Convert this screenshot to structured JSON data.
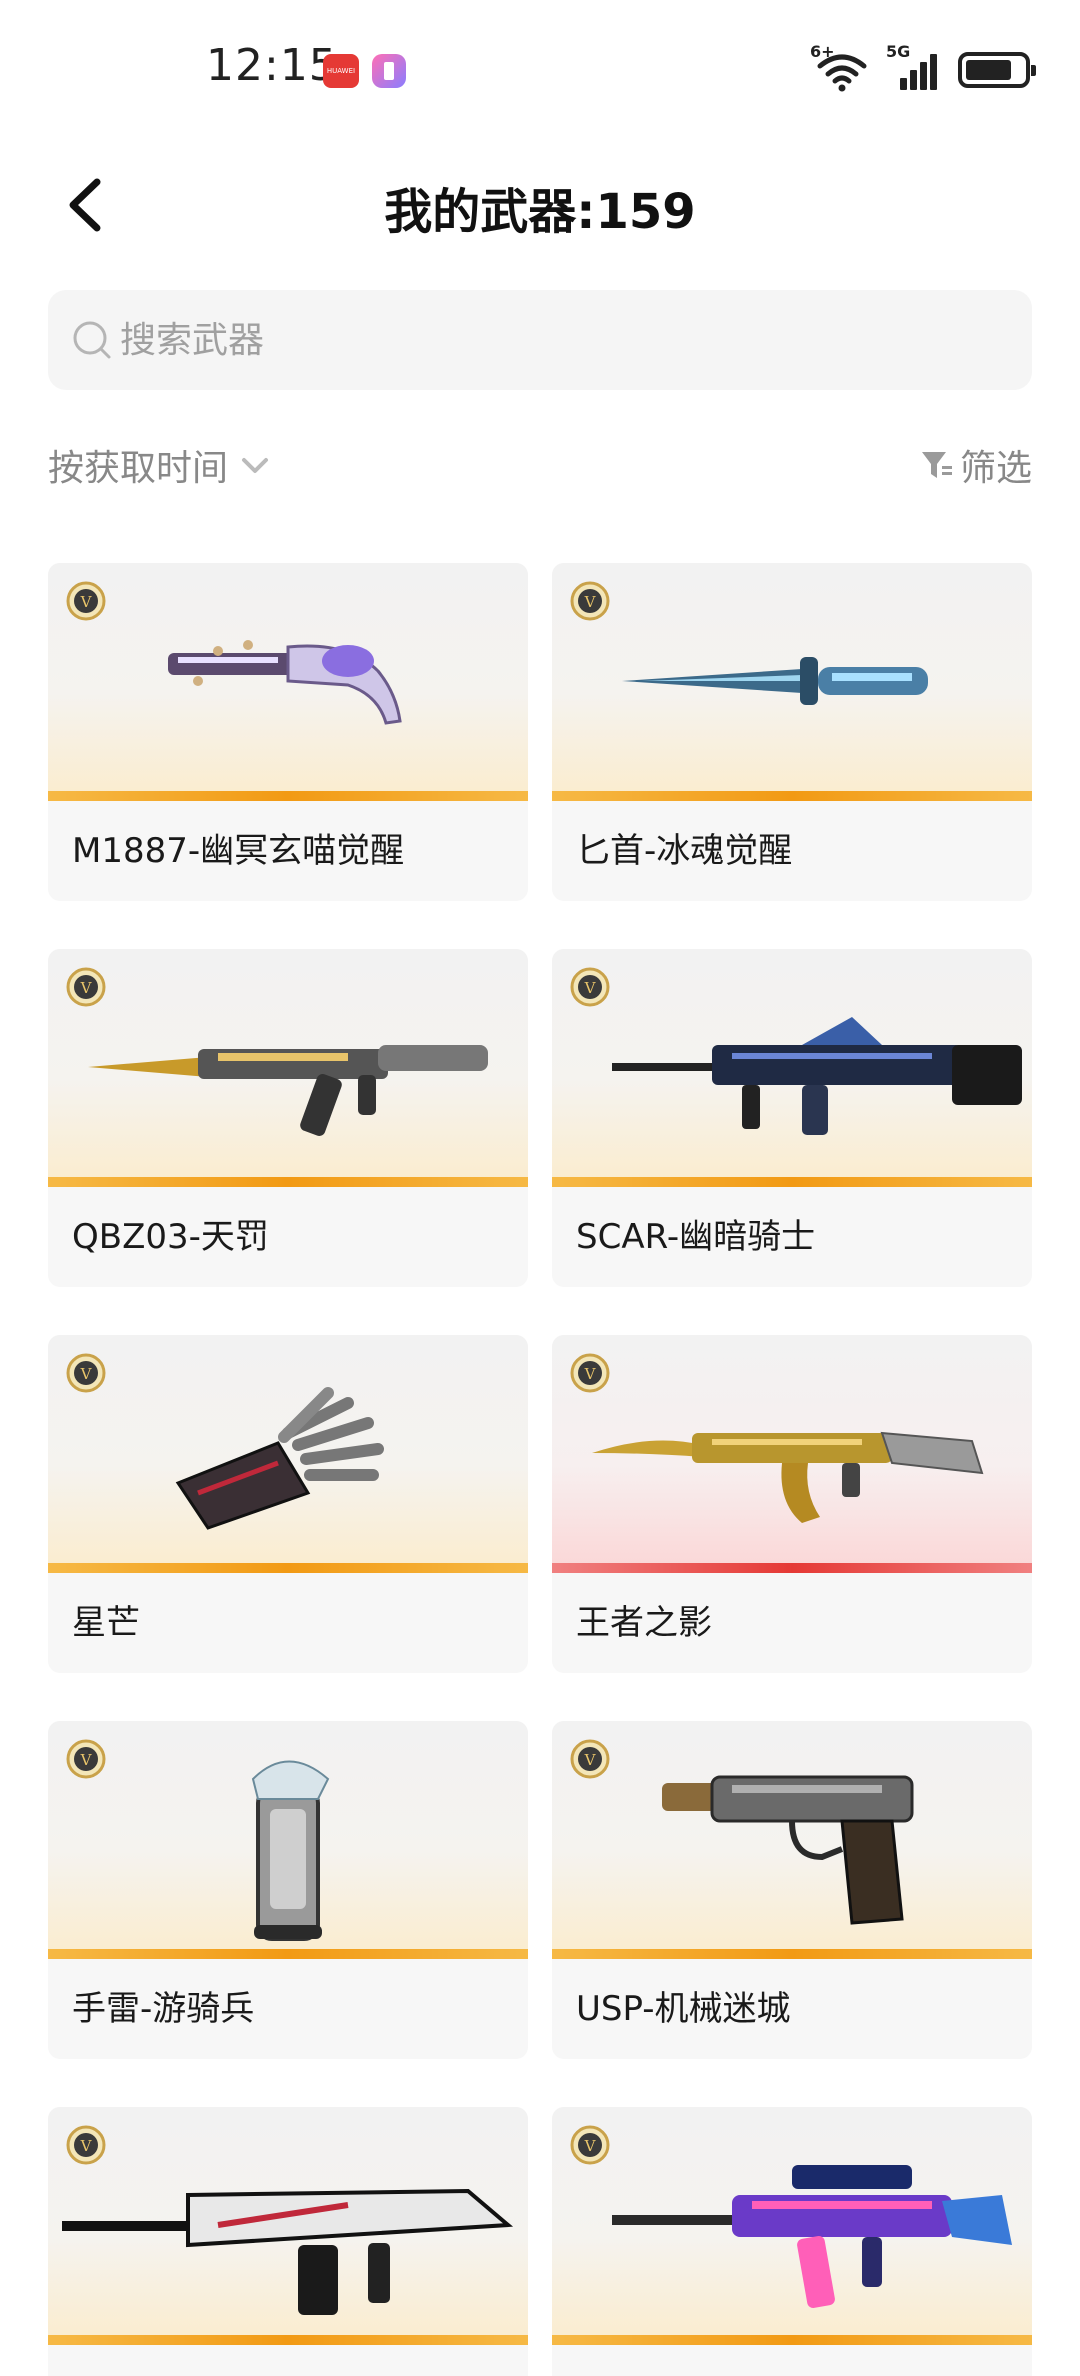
{
  "status_bar": {
    "time": "12:15",
    "huawei_badge": "HUAWEI",
    "wifi_tag": "6+",
    "network_tag": "5G",
    "battery_level": 0.7
  },
  "header": {
    "title": "我的武器:159"
  },
  "search": {
    "placeholder": "搜索武器",
    "value": ""
  },
  "toolbar": {
    "sort_label": "按获取时间",
    "filter_label": "筛选"
  },
  "colors": {
    "gold_bar": "#f29a14",
    "red_bar": "#e53935",
    "badge_gold": "#c9a24a"
  },
  "weapons": [
    {
      "name": "M1887-幽冥玄喵觉醒",
      "rarity": "gold",
      "icon": "shotgun-icon"
    },
    {
      "name": "匕首-冰魂觉醒",
      "rarity": "gold",
      "icon": "dagger-icon"
    },
    {
      "name": "QBZ03-天罚",
      "rarity": "gold",
      "icon": "rifle-icon"
    },
    {
      "name": "SCAR-幽暗骑士",
      "rarity": "gold",
      "icon": "rifle-icon"
    },
    {
      "name": "星芒",
      "rarity": "gold",
      "icon": "gauntlet-icon"
    },
    {
      "name": "王者之影",
      "rarity": "red",
      "icon": "rifle-icon"
    },
    {
      "name": "手雷-游骑兵",
      "rarity": "gold",
      "icon": "grenade-icon"
    },
    {
      "name": "USP-机械迷城",
      "rarity": "gold",
      "icon": "pistol-icon"
    },
    {
      "name": "",
      "rarity": "gold",
      "icon": "rifle-icon"
    },
    {
      "name": "",
      "rarity": "gold",
      "icon": "rifle-icon"
    }
  ]
}
